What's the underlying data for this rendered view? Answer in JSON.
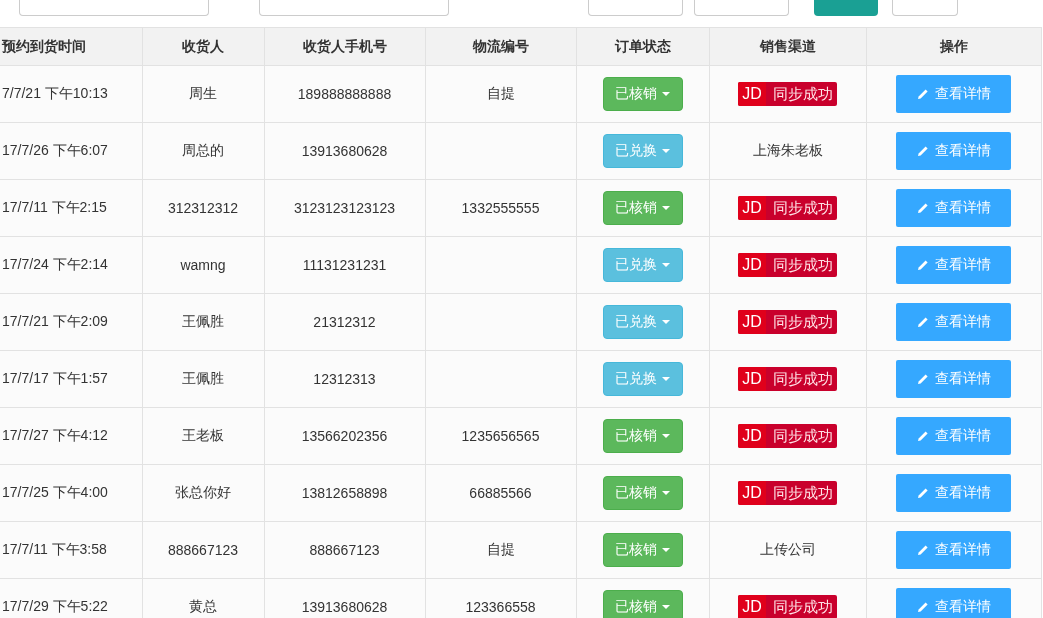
{
  "table": {
    "columns": [
      "预约到货时间",
      "收货人",
      "收货人手机号",
      "物流编号",
      "订单状态",
      "销售渠道",
      "操作"
    ],
    "rows": [
      {
        "time": "7/7/21 下午10:13",
        "receiver": "周生",
        "phone": "189888888888",
        "logistics": "自提",
        "status": {
          "kind": "verified",
          "label": "已核销"
        },
        "channel": {
          "kind": "jd",
          "logo": "JD",
          "label": "同步成功"
        },
        "action": "查看详情"
      },
      {
        "time": "17/7/26 下午6:07",
        "receiver": "周总的",
        "phone": "13913680628",
        "status": {
          "kind": "exchanged",
          "label": "已兑换"
        },
        "channel": {
          "kind": "text",
          "label": "上海朱老板"
        },
        "action": "查看详情"
      },
      {
        "time": "17/7/11 下午2:15",
        "receiver": "312312312",
        "phone": "3123123123123",
        "logistics": "1332555555",
        "status": {
          "kind": "verified",
          "label": "已核销"
        },
        "channel": {
          "kind": "jd",
          "logo": "JD",
          "label": "同步成功"
        },
        "action": "查看详情"
      },
      {
        "time": "17/7/24 下午2:14",
        "receiver": "wamng",
        "phone": "11131231231",
        "status": {
          "kind": "exchanged",
          "label": "已兑换"
        },
        "channel": {
          "kind": "jd",
          "logo": "JD",
          "label": "同步成功"
        },
        "action": "查看详情"
      },
      {
        "time": "17/7/21 下午2:09",
        "receiver": "王佩胜",
        "phone": "21312312",
        "status": {
          "kind": "exchanged",
          "label": "已兑换"
        },
        "channel": {
          "kind": "jd",
          "logo": "JD",
          "label": "同步成功"
        },
        "action": "查看详情"
      },
      {
        "time": "17/7/17 下午1:57",
        "receiver": "王佩胜",
        "phone": "12312313",
        "status": {
          "kind": "exchanged",
          "label": "已兑换"
        },
        "channel": {
          "kind": "jd",
          "logo": "JD",
          "label": "同步成功"
        },
        "action": "查看详情"
      },
      {
        "time": "17/7/27 下午4:12",
        "receiver": "王老板",
        "phone": "13566202356",
        "logistics": "1235656565",
        "status": {
          "kind": "verified",
          "label": "已核销"
        },
        "channel": {
          "kind": "jd",
          "logo": "JD",
          "label": "同步成功"
        },
        "action": "查看详情"
      },
      {
        "time": "17/7/25 下午4:00",
        "receiver": "张总你好",
        "phone": "13812658898",
        "logistics": "66885566",
        "status": {
          "kind": "verified",
          "label": "已核销"
        },
        "channel": {
          "kind": "jd",
          "logo": "JD",
          "label": "同步成功"
        },
        "action": "查看详情"
      },
      {
        "time": "17/7/11 下午3:58",
        "receiver": "888667123",
        "phone": "888667123",
        "logistics": "自提",
        "status": {
          "kind": "verified",
          "label": "已核销"
        },
        "channel": {
          "kind": "text",
          "label": "上传公司"
        },
        "action": "查看详情"
      },
      {
        "time": "17/7/29 下午5:22",
        "receiver": "黄总",
        "phone": "13913680628",
        "logistics": "123366558",
        "status": {
          "kind": "verified",
          "label": "已核销"
        },
        "channel": {
          "kind": "jd",
          "logo": "JD",
          "label": "同步成功"
        },
        "action": "查看详情"
      }
    ]
  }
}
